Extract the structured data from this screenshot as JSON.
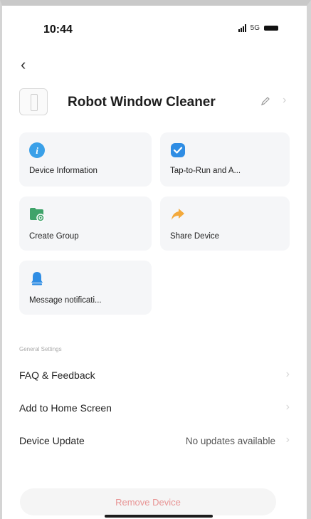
{
  "status": {
    "time": "10:44",
    "network": "5G"
  },
  "device": {
    "name": "Robot Window Cleaner"
  },
  "cards": [
    {
      "label": "Device Information",
      "icon": "info-icon",
      "color": "#3aa0e8"
    },
    {
      "label": "Tap-to-Run and A...",
      "icon": "check-shield-icon",
      "color": "#2f8de4"
    },
    {
      "label": "Create Group",
      "icon": "group-icon",
      "color": "#3fa36a"
    },
    {
      "label": "Share Device",
      "icon": "share-arrow-icon",
      "color": "#f3a93c"
    },
    {
      "label": "Message notificati...",
      "icon": "bell-icon",
      "color": "#2f8de4"
    }
  ],
  "general_settings": {
    "title": "General Settings",
    "items": [
      {
        "label": "FAQ & Feedback",
        "value": ""
      },
      {
        "label": "Add to Home Screen",
        "value": ""
      },
      {
        "label": "Device Update",
        "value": "No updates available"
      }
    ]
  },
  "remove_label": "Remove Device",
  "colors": {
    "remove_text": "#e89494",
    "card_bg": "#f5f6f8"
  }
}
